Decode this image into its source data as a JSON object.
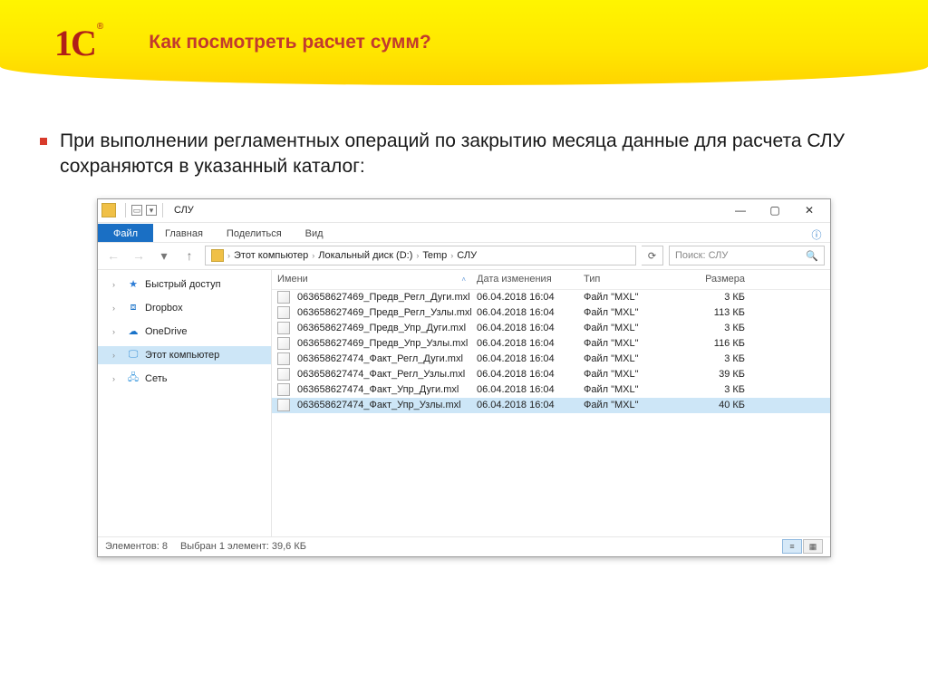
{
  "slide": {
    "logo_text": "1С",
    "title": "Как посмотреть расчет сумм?",
    "body": "При выполнении регламентных операций по закрытию месяца данные для расчета СЛУ сохраняются в указанный каталог:"
  },
  "explorer": {
    "window_title": "СЛУ",
    "ribbon": {
      "file": "Файл",
      "tabs": [
        "Главная",
        "Поделиться",
        "Вид"
      ]
    },
    "breadcrumb": [
      "Этот компьютер",
      "Локальный диск (D:)",
      "Temp",
      "СЛУ"
    ],
    "search_placeholder": "Поиск: СЛУ",
    "nav": [
      {
        "label": "Быстрый доступ",
        "iconClass": "star"
      },
      {
        "label": "Dropbox",
        "iconClass": "dropbox"
      },
      {
        "label": "OneDrive",
        "iconClass": "onedrive"
      },
      {
        "label": "Этот компьютер",
        "iconClass": "pc",
        "selected": true
      },
      {
        "label": "Сеть",
        "iconClass": "net"
      }
    ],
    "columns": {
      "name": "Имени",
      "date": "Дата изменения",
      "type": "Тип",
      "size": "Размера"
    },
    "files": [
      {
        "name": "063658627469_Предв_Регл_Дуги.mxl",
        "date": "06.04.2018 16:04",
        "type": "Файл \"MXL\"",
        "size": "3 КБ"
      },
      {
        "name": "063658627469_Предв_Регл_Узлы.mxl",
        "date": "06.04.2018 16:04",
        "type": "Файл \"MXL\"",
        "size": "113 КБ"
      },
      {
        "name": "063658627469_Предв_Упр_Дуги.mxl",
        "date": "06.04.2018 16:04",
        "type": "Файл \"MXL\"",
        "size": "3 КБ"
      },
      {
        "name": "063658627469_Предв_Упр_Узлы.mxl",
        "date": "06.04.2018 16:04",
        "type": "Файл \"MXL\"",
        "size": "116 КБ"
      },
      {
        "name": "063658627474_Факт_Регл_Дуги.mxl",
        "date": "06.04.2018 16:04",
        "type": "Файл \"MXL\"",
        "size": "3 КБ"
      },
      {
        "name": "063658627474_Факт_Регл_Узлы.mxl",
        "date": "06.04.2018 16:04",
        "type": "Файл \"MXL\"",
        "size": "39 КБ"
      },
      {
        "name": "063658627474_Факт_Упр_Дуги.mxl",
        "date": "06.04.2018 16:04",
        "type": "Файл \"MXL\"",
        "size": "3 КБ"
      },
      {
        "name": "063658627474_Факт_Упр_Узлы.mxl",
        "date": "06.04.2018 16:04",
        "type": "Файл \"MXL\"",
        "size": "40 КБ",
        "selected": true
      }
    ],
    "status": {
      "count": "Элементов: 8",
      "selection": "Выбран 1 элемент: 39,6 КБ"
    }
  }
}
